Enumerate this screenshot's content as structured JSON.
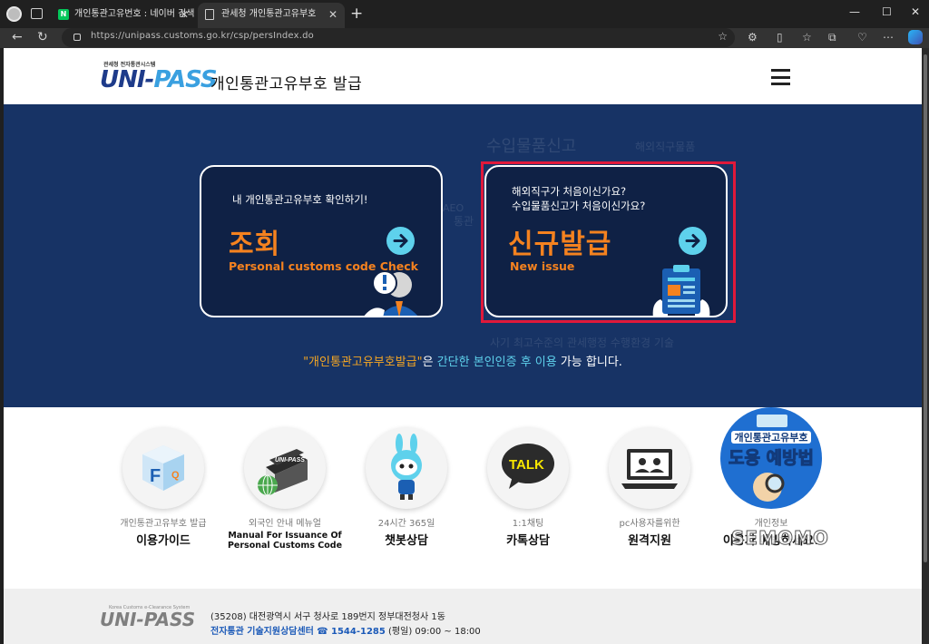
{
  "browser": {
    "tabs": [
      {
        "title": "개인통관고유번호 : 네이버 검색",
        "favicon": "naver-icon",
        "favicon_text": "N",
        "active": false
      },
      {
        "title": "관세청 개인통관고유부호",
        "favicon": "document-icon",
        "active": true
      }
    ],
    "url": "https://unipass.customs.go.kr/csp/persIndex.do"
  },
  "header": {
    "logo_top": "관세청 전자통관시스템",
    "logo_uni": "UNI-",
    "logo_pass": "PASS",
    "title": "개인통관고유부호  발급"
  },
  "background_words": [
    "수입물품신고",
    "해외직구물품",
    "통관",
    "AEO",
    "사기 최고수준의 관세행정 수행환경 기술"
  ],
  "cards": [
    {
      "subtitle_lines": [
        "내 개인통관고유부호 확인하기!"
      ],
      "title": "조회",
      "subtitle_en": "Personal customs code Check"
    },
    {
      "subtitle_lines": [
        "해외직구가 처음이신가요?",
        "수입물품신고가 처음이신가요?"
      ],
      "title": "신규발급",
      "subtitle_en": "New issue"
    }
  ],
  "notice": {
    "part1": "\"개인통관고유부호발급\"",
    "part2": "은 ",
    "part3": "간단한 본인인증 후 이용",
    "part4": " 가능 합니다."
  },
  "services": [
    {
      "sub": "개인통관고유부호 발급",
      "label": "이용가이드",
      "icon": "faq-cube-icon"
    },
    {
      "sub": "외국인 안내 메뉴얼",
      "label": "Manual For Issuance Of Personal Customs Code",
      "icon": "manual-book-icon"
    },
    {
      "sub": "24시간 365일",
      "label": "챗봇상담",
      "icon": "chatbot-mascot-icon"
    },
    {
      "sub": "1:1채팅",
      "label": "카톡상담",
      "icon": "kakaotalk-icon",
      "icon_text": "TALK"
    },
    {
      "sub": "pc사용자를위한",
      "label": "원격지원",
      "icon": "remote-support-icon"
    },
    {
      "sub": "개인정보",
      "label": "이용자 예방하세요!",
      "icon": "theft-prevention-icon",
      "banner_top": "개인통관고유부호",
      "banner_bottom": "도용 예방법"
    }
  ],
  "footer": {
    "logo": "UNI-PASS",
    "logo_small": "Korea Customs e-Clearance System",
    "address": "(35208) 대전광역시 서구 청사로 189번지 정부대전청사 1동",
    "center": "전자통관 기술지원상담센터",
    "phone": "☎ 1544-1285",
    "hours": "(평일) 09:00 ~ 18:00"
  },
  "watermark": "SEMOMO",
  "colors": {
    "hero_bg": "#173365",
    "card_bg": "#0f2145",
    "accent_orange": "#f5821f",
    "accent_cyan": "#5ed1ec",
    "highlight_red": "#e0193a"
  }
}
